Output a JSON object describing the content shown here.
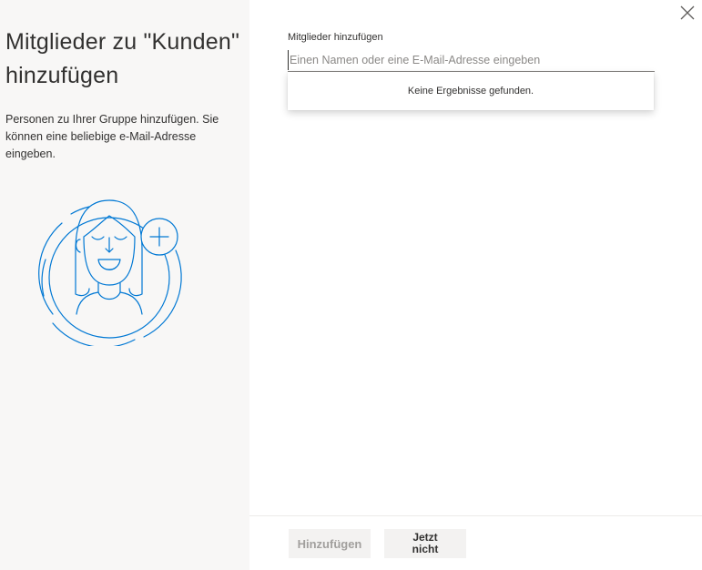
{
  "left_panel": {
    "title": "Mitglieder zu \"Kunden\" hinzufügen",
    "description": "Personen zu Ihrer Gruppe hinzufügen. Sie können eine beliebige e-Mail-Adresse eingeben.",
    "illustration_icon": "person-add-illustration"
  },
  "form": {
    "label": "Mitglieder hinzufügen",
    "search_value": "",
    "search_placeholder": "Einen Namen oder eine E-Mail-Adresse eingeben",
    "no_results": "Keine Ergebnisse gefunden."
  },
  "close_icon": "close-icon",
  "footer": {
    "add_label": "Hinzufügen",
    "not_now_label": "Jetzt nicht"
  },
  "colors": {
    "accent": "#0078d4",
    "left_panel_bg": "#f8f7f6",
    "disabled_text": "#a19f9d"
  }
}
